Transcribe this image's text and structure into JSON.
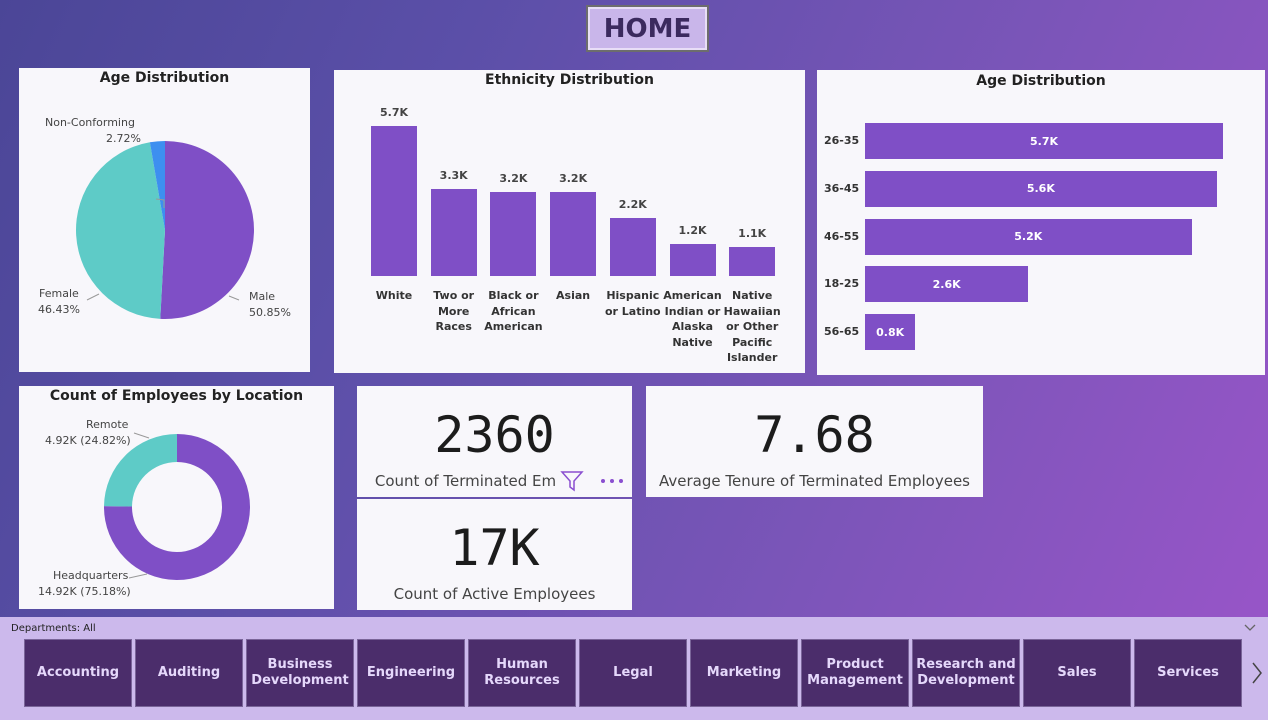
{
  "home_label": "HOME",
  "age_pie": {
    "title": "Age Distribution",
    "slices": [
      {
        "name": "Male",
        "pct": "50.85%",
        "value": 50.85,
        "color": "#7f4fc6"
      },
      {
        "name": "Female",
        "pct": "46.43%",
        "value": 46.43,
        "color": "#5ecbc7"
      },
      {
        "name": "Non-Conforming",
        "pct": "2.72%",
        "value": 2.72,
        "color": "#3d8ff0"
      }
    ]
  },
  "ethnicity": {
    "title": "Ethnicity Distribution",
    "bars": [
      {
        "value": 5.7,
        "label": "5.7K",
        "cat": "White"
      },
      {
        "value": 3.3,
        "label": "3.3K",
        "cat": "Two or More Races"
      },
      {
        "value": 3.2,
        "label": "3.2K",
        "cat": "Black or African American"
      },
      {
        "value": 3.2,
        "label": "3.2K",
        "cat": "Asian"
      },
      {
        "value": 2.2,
        "label": "2.2K",
        "cat": "Hispanic or Latino"
      },
      {
        "value": 1.2,
        "label": "1.2K",
        "cat": "American Indian or Alaska Native"
      },
      {
        "value": 1.1,
        "label": "1.1K",
        "cat": "Native Hawaiian or Other Pacific Islander"
      }
    ]
  },
  "age_bars": {
    "title": "Age Distribution",
    "bars": [
      {
        "cat": "26-35",
        "value": 5.7,
        "label": "5.7K"
      },
      {
        "cat": "36-45",
        "value": 5.6,
        "label": "5.6K"
      },
      {
        "cat": "46-55",
        "value": 5.2,
        "label": "5.2K"
      },
      {
        "cat": "18-25",
        "value": 2.6,
        "label": "2.6K"
      },
      {
        "cat": "56-65",
        "value": 0.8,
        "label": "0.8K"
      }
    ]
  },
  "location": {
    "title": "Count of Employees by Location",
    "slices": [
      {
        "name": "Headquarters",
        "label": "14.92K (75.18%)",
        "value": 75.18,
        "color": "#7f4fc6"
      },
      {
        "name": "Remote",
        "label": "4.92K (24.82%)",
        "value": 24.82,
        "color": "#5ecbc7"
      }
    ]
  },
  "kpi_terminated": {
    "value": "2360",
    "label": "Count of Terminated Employees"
  },
  "kpi_active": {
    "value": "17K",
    "label": "Count of Active Employees"
  },
  "kpi_tenure": {
    "value": "7.68",
    "label": "Average Tenure of Terminated Employees"
  },
  "departments": {
    "title": "Departments: All",
    "items": [
      "Accounting",
      "Auditing",
      "Business Development",
      "Engineering",
      "Human Resources",
      "Legal",
      "Marketing",
      "Product Management",
      "Research and Development",
      "Sales",
      "Services"
    ]
  },
  "chart_data": [
    {
      "type": "pie",
      "title": "Age Distribution",
      "categories": [
        "Male",
        "Female",
        "Non-Conforming"
      ],
      "values": [
        50.85,
        46.43,
        2.72
      ]
    },
    {
      "type": "bar",
      "title": "Ethnicity Distribution",
      "categories": [
        "White",
        "Two or More Races",
        "Black or African American",
        "Asian",
        "Hispanic or Latino",
        "American Indian or Alaska Native",
        "Native Hawaiian or Other Pacific Islander"
      ],
      "values": [
        5.7,
        3.3,
        3.2,
        3.2,
        2.2,
        1.2,
        1.1
      ]
    },
    {
      "type": "bar",
      "title": "Age Distribution",
      "categories": [
        "26-35",
        "36-45",
        "46-55",
        "18-25",
        "56-65"
      ],
      "values": [
        5.7,
        5.6,
        5.2,
        2.6,
        0.8
      ]
    },
    {
      "type": "pie",
      "title": "Count of Employees by Location",
      "categories": [
        "Headquarters",
        "Remote"
      ],
      "values": [
        14.92,
        4.92
      ]
    }
  ]
}
